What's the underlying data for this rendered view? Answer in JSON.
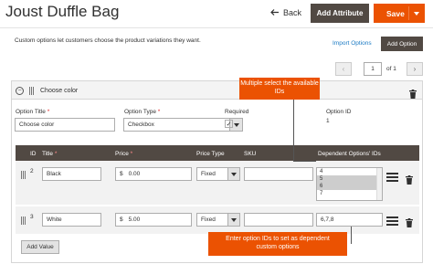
{
  "header": {
    "title": "Joust Duffle Bag",
    "back_label": "Back",
    "add_attribute_label": "Add Attribute",
    "save_label": "Save"
  },
  "custom_options": {
    "description": "Custom options let customers choose the product variations they want.",
    "import_label": "Import Options",
    "add_option_label": "Add Option"
  },
  "pager": {
    "current_page": "1",
    "of_text": "of 1"
  },
  "option": {
    "header_title": "Choose color",
    "title_label": "Option Title",
    "title_value": "Choose color",
    "type_label": "Option Type",
    "type_value": "Checkbox",
    "required_label": "Required",
    "required_checked": true,
    "option_id_label": "Option ID",
    "option_id_value": "1"
  },
  "grid": {
    "columns": {
      "id": "ID",
      "title": "Title",
      "price": "Price",
      "price_type": "Price Type",
      "sku": "SKU",
      "dependent_ids": "Dependent Options' IDs"
    },
    "rows": [
      {
        "id": "2",
        "title": "Black",
        "currency": "$",
        "price": "0.00",
        "price_type": "Fixed",
        "sku": "",
        "dependent_options": [
          "4",
          "5",
          "6",
          "7"
        ],
        "selected_options": [
          "5",
          "6"
        ]
      },
      {
        "id": "3",
        "title": "White",
        "currency": "$",
        "price": "5.00",
        "price_type": "Fixed",
        "sku": "",
        "dependent_ids": "6,7,8"
      }
    ],
    "add_value_label": "Add Value"
  },
  "callouts": {
    "multiselect": "Multiple select the available IDs",
    "enter_ids": "Enter option IDs to set as dependent custom options"
  },
  "colors": {
    "accent": "#eb5202",
    "dark_button": "#514943",
    "link": "#1979c3"
  }
}
